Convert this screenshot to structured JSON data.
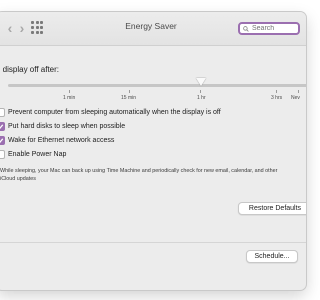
{
  "window": {
    "title": "Energy Saver"
  },
  "toolbar": {
    "back_icon": "chevron-left-icon",
    "forward_icon": "chevron-right-icon",
    "grid_icon": "show-all-grid-icon"
  },
  "search": {
    "placeholder": "Search",
    "value": ""
  },
  "display_sleep": {
    "label": "n display off after:",
    "value": "1 hr",
    "ticks": [
      "1 min",
      "15 min",
      "1 hr",
      "3 hrs",
      "Nev"
    ]
  },
  "options": [
    {
      "label": "Prevent computer from sleeping automatically when the display is off",
      "checked": false
    },
    {
      "label": "Put hard disks to sleep when possible",
      "checked": true
    },
    {
      "label": "Wake for Ethernet network access",
      "checked": true
    },
    {
      "label": "Enable Power Nap",
      "checked": false
    }
  ],
  "power_nap_note": "While sleeping, your Mac can back up using Time Machine and periodically check for new email, calendar, and other iCloud updates",
  "buttons": {
    "restore": "Restore Defaults",
    "schedule": "Schedule..."
  },
  "accent_color": "#9b6fb0"
}
